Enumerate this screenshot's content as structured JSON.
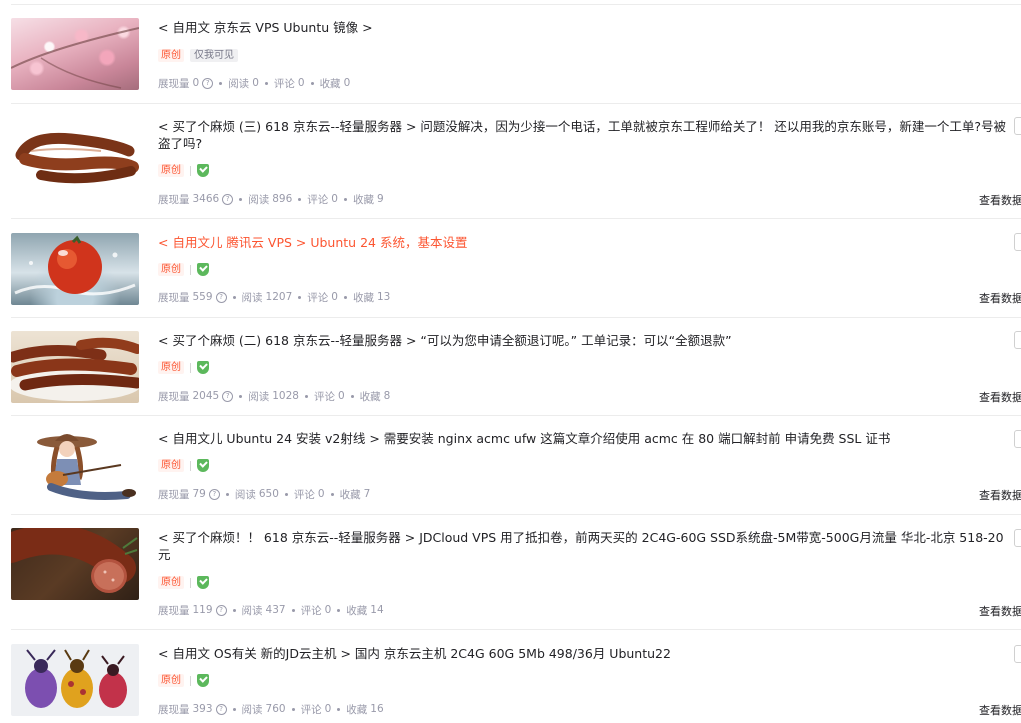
{
  "common": {
    "original_tag": "原创",
    "view_data_label": "查看数据",
    "help_glyph": "?",
    "stat_labels": {
      "impressions": "展现量",
      "reads": "阅读",
      "comments": "评论",
      "favorites": "收藏"
    }
  },
  "articles": [
    {
      "title": "< 自用文 京东云 VPS Ubuntu 镜像 >",
      "visibility_tag": "仅我可见",
      "thumb_icon": "cherry-blossom-image",
      "impressions": "0",
      "reads": "0",
      "comments": "0",
      "favorites": "0"
    },
    {
      "title": "< 买了个麻烦 (三) 618 京东云--轻量服务器 > 问题没解决，因为少接一个电话，工单就被京东工程师给关了！ 还以用我的京东账号，新建一个工单?号被盗了吗?",
      "thumb_icon": "sausage-image",
      "impressions": "3466",
      "reads": "896",
      "comments": "0",
      "favorites": "9"
    },
    {
      "title": "< 自用文儿 腾讯云 VPS > Ubuntu 24 系统，基本设置",
      "title_color": "#fc5531",
      "thumb_icon": "tomato-splash-image",
      "impressions": "559",
      "reads": "1207",
      "comments": "0",
      "favorites": "13"
    },
    {
      "title": "< 买了个麻烦 (二) 618 京东云--轻量服务器 > “可以为您申请全额退订呢。” 工单记录：可以“全额退款”",
      "thumb_icon": "grilled-sausages-image",
      "impressions": "2045",
      "reads": "1028",
      "comments": "0",
      "favorites": "8"
    },
    {
      "title": "< 自用文儿 Ubuntu 24 安装 v2射线 > 需要安装 nginx acmc ufw 这篇文章介绍使用 acmc 在 80 端口解封前 申请免费 SSL 证书",
      "thumb_icon": "cowgirl-guitar-image",
      "impressions": "79",
      "reads": "650",
      "comments": "0",
      "favorites": "7"
    },
    {
      "title": "< 买了个麻烦！！ 618 京东云--轻量服务器 > JDCloud VPS 用了抵扣卷，前两天买的 2C4G-60G SSD系统盘-5M带宽-500G月流量 华北-北京 518-20元",
      "thumb_icon": "sliced-sausage-image",
      "impressions": "119",
      "reads": "437",
      "comments": "0",
      "favorites": "14"
    },
    {
      "title": "< 自用文 OS有关 新的JD云主机 > 国内 京东云主机 2C4G 60G 5Mb 498/36月 Ubuntu22",
      "thumb_icon": "beetles-image",
      "impressions": "393",
      "reads": "760",
      "comments": "0",
      "favorites": "16"
    }
  ]
}
